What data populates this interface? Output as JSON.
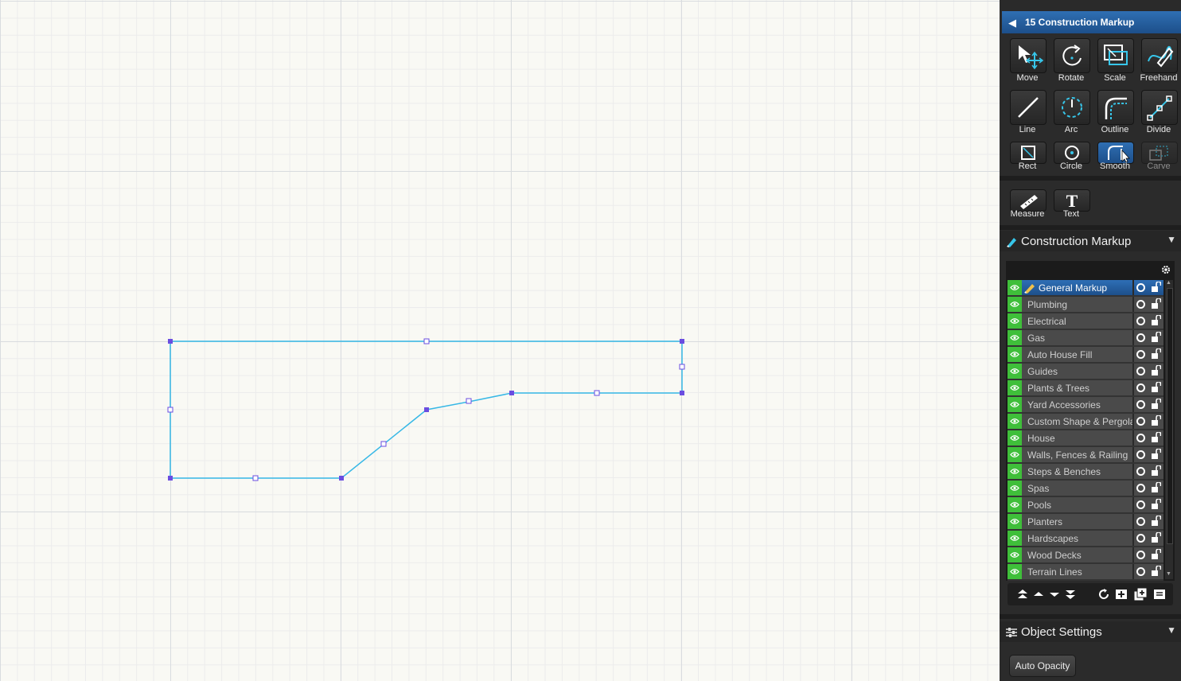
{
  "panel": {
    "header_title": "15 Construction Markup",
    "tools": [
      {
        "label": "Move",
        "icon": "move-icon"
      },
      {
        "label": "Rotate",
        "icon": "rotate-icon"
      },
      {
        "label": "Scale",
        "icon": "scale-icon"
      },
      {
        "label": "Freehand",
        "icon": "freehand-icon"
      },
      {
        "label": "Line",
        "icon": "line-icon"
      },
      {
        "label": "Arc",
        "icon": "arc-icon"
      },
      {
        "label": "Outline",
        "icon": "outline-icon"
      },
      {
        "label": "Divide",
        "icon": "divide-icon"
      },
      {
        "label": "Rect",
        "icon": "rect-icon"
      },
      {
        "label": "Circle",
        "icon": "circle-icon"
      },
      {
        "label": "Smooth",
        "icon": "smooth-icon"
      },
      {
        "label": "Carve",
        "icon": "carve-icon"
      }
    ],
    "extra_tools": [
      {
        "label": "Measure",
        "icon": "ruler-icon"
      },
      {
        "label": "Text",
        "icon": "text-icon"
      }
    ],
    "section_title": "Construction Markup",
    "layers": [
      "General Markup",
      "Plumbing",
      "Electrical",
      "Gas",
      "Auto House Fill",
      "Guides",
      "Plants & Trees",
      "Yard Accessories",
      "Custom Shape & Pergola",
      "House",
      "Walls, Fences & Railing",
      "Steps & Benches",
      "Spas",
      "Pools",
      "Planters",
      "Hardscapes",
      "Wood Decks",
      "Terrain Lines"
    ],
    "selected_layer": "General Markup",
    "object_settings_title": "Object Settings",
    "auto_opacity_label": "Auto Opacity"
  },
  "colors": {
    "accent": "#1d4f8a",
    "shape_stroke": "#37b8e6",
    "handle": "#6a4de0",
    "layer_visible": "#3fbf3a"
  }
}
